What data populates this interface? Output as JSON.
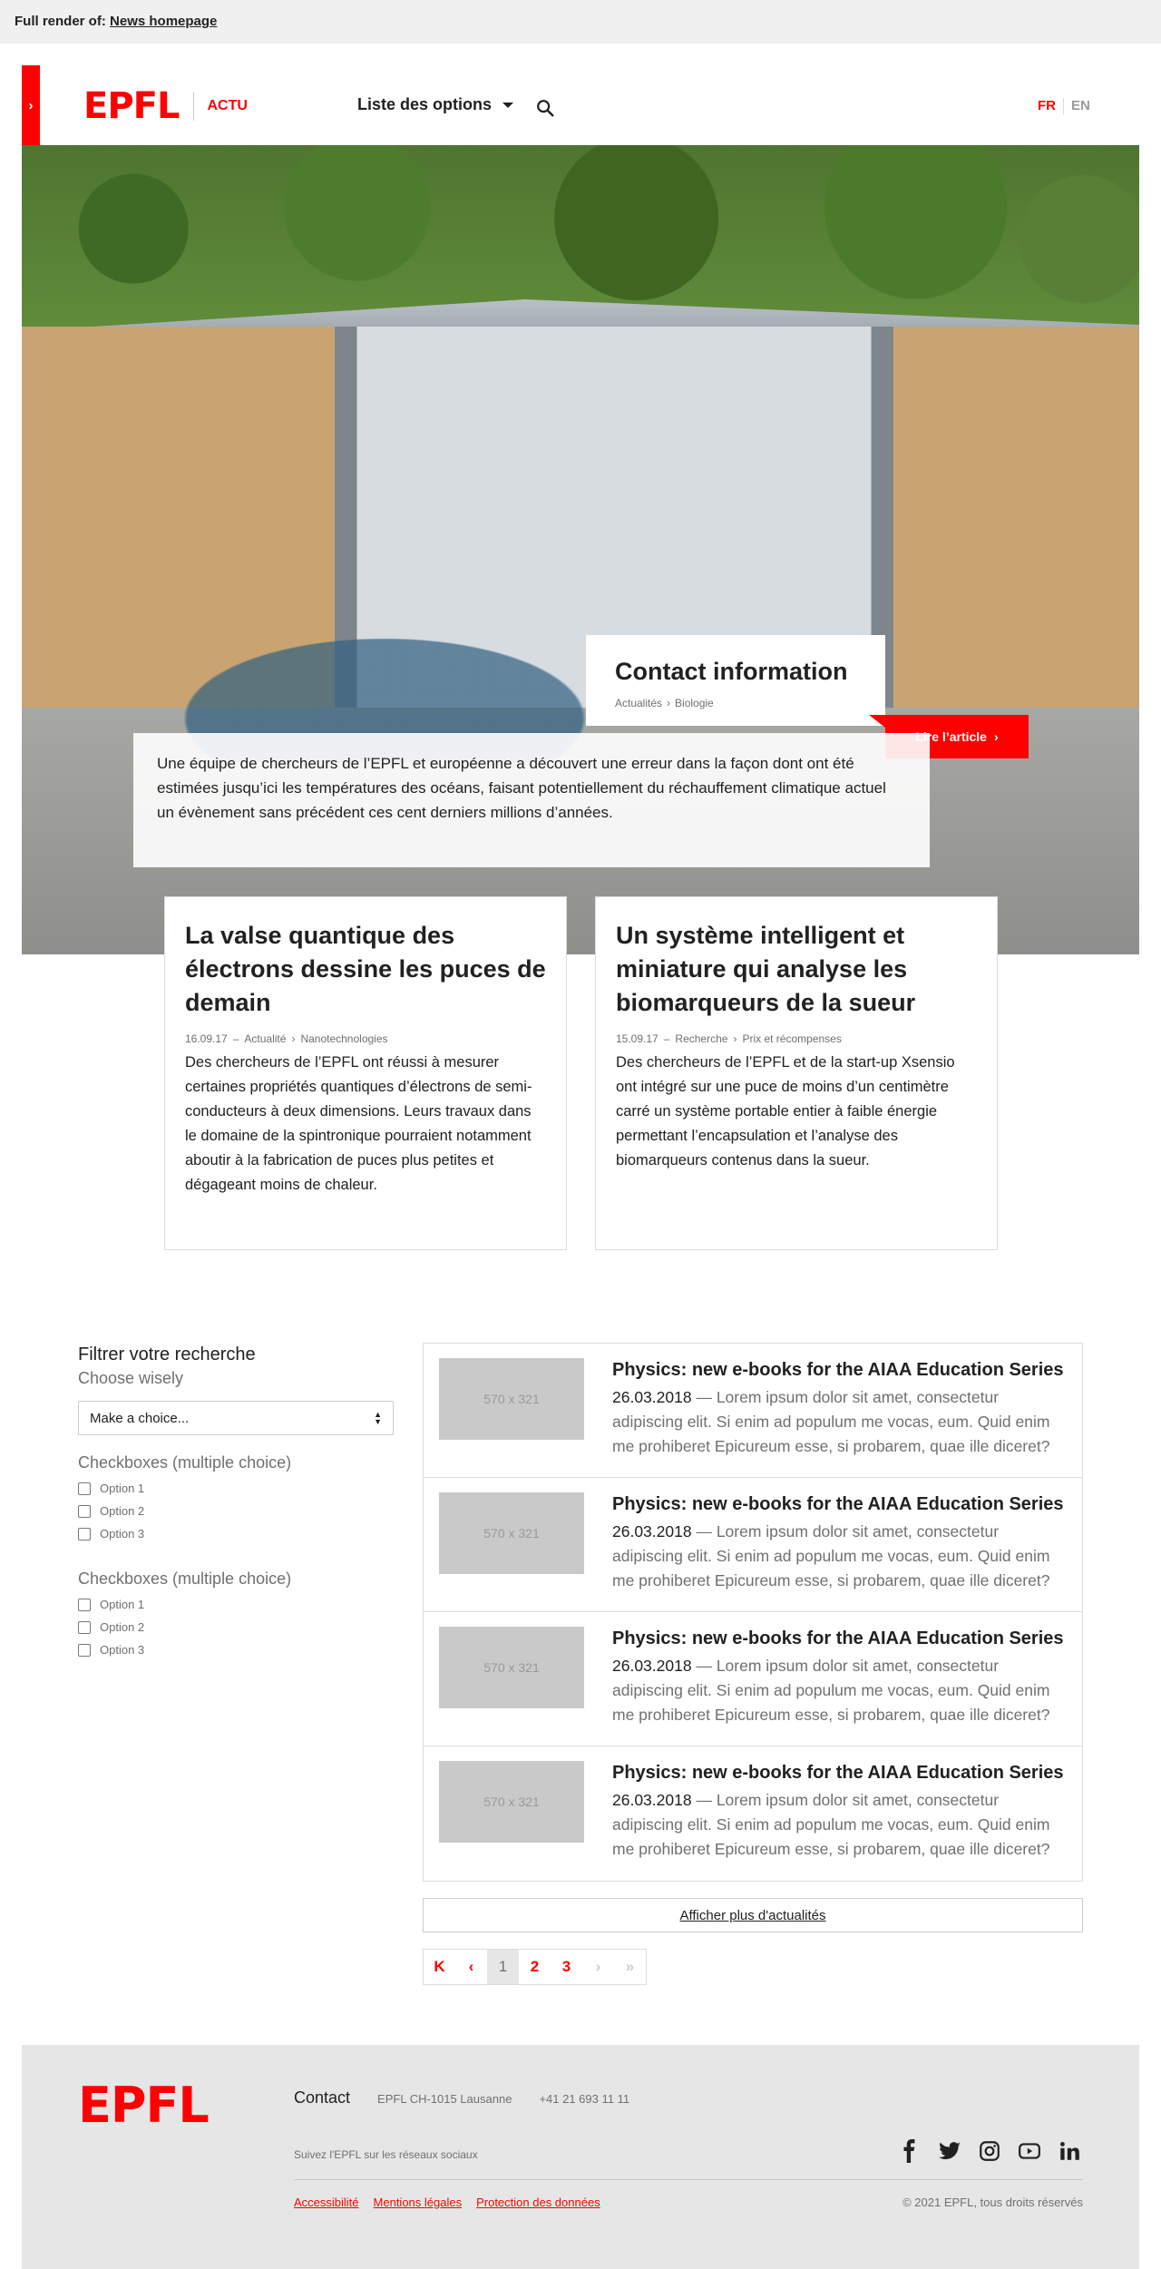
{
  "render_bar": {
    "prefix": "Full render of:",
    "link": "News homepage"
  },
  "header": {
    "drawer_glyph": "›",
    "logo": "EPFL",
    "site_name": "ACTU",
    "menu_label": "Liste des options",
    "languages": {
      "active": "FR",
      "inactive": "EN"
    }
  },
  "hero": {
    "title": "Contact information",
    "breadcrumb": [
      "Actualités",
      "Biologie"
    ],
    "read_label": "Lire l’article",
    "excerpt": "Une équipe de chercheurs de l’EPFL et européenne a découvert une erreur dans la façon dont ont été estimées jusqu’ici les températures des océans, faisant potentiellement du réchauffement climatique actuel un évènement sans précédent ces cent derniers millions d’années."
  },
  "cards": [
    {
      "title": "La valse quantique des électrons dessine les puces de demain",
      "date": "16.09.17",
      "category": "Actualité",
      "topic": "Nanotechnologies",
      "text": "Des chercheurs de l’EPFL ont réussi à mesurer certaines propriétés quantiques d’électrons de semi-conducteurs à deux dimensions. Leurs travaux dans le domaine de la spintronique pourraient notamment aboutir à la fabrication de puces plus petites et dégageant moins de chaleur."
    },
    {
      "title": "Un système intelligent et miniature qui analyse les biomarqueurs de la sueur",
      "date": "15.09.17",
      "category": "Recherche",
      "topic": "Prix et récompenses",
      "text": "Des chercheurs de l’EPFL et de la start-up Xsensio ont intégré sur une puce de moins d’un centimètre carré un système portable entier à faible énergie permettant l’encapsulation et l’analyse des biomarqueurs contenus dans la sueur."
    }
  ],
  "filter": {
    "title": "Filtrer votre recherche",
    "subtitle": "Choose wisely",
    "select_value": "Make a choice...",
    "groups": [
      {
        "label": "Checkboxes (multiple choice)",
        "options": [
          "Option 1",
          "Option 2",
          "Option 3"
        ]
      },
      {
        "label": "Checkboxes (multiple choice)",
        "options": [
          "Option 1",
          "Option 2",
          "Option 3"
        ]
      }
    ]
  },
  "news": [
    {
      "thumb": "570 x 321",
      "title": "Physics: new e-books for the AIAA Education Series",
      "date": "26.03.2018",
      "text": " — Lorem ipsum dolor sit amet, consectetur adipiscing elit. Si enim ad populum me vocas, eum. Quid enim me prohiberet Epicureum esse, si probarem, quae ille diceret?"
    },
    {
      "thumb": "570 x 321",
      "title": "Physics: new e-books for the AIAA Education Series",
      "date": "26.03.2018",
      "text": " — Lorem ipsum dolor sit amet, consectetur adipiscing elit. Si enim ad populum me vocas, eum. Quid enim me prohiberet Epicureum esse, si probarem, quae ille diceret?"
    },
    {
      "thumb": "570 x 321",
      "title": "Physics: new e-books for the AIAA Education Series",
      "date": "26.03.2018",
      "text": " — Lorem ipsum dolor sit amet, consectetur adipiscing elit. Si enim ad populum me vocas, eum. Quid enim me prohiberet Epicureum esse, si probarem, quae ille diceret?"
    },
    {
      "thumb": "570 x 321",
      "title": "Physics: new e-books for the AIAA Education Series",
      "date": "26.03.2018",
      "text": " — Lorem ipsum dolor sit amet, consectetur adipiscing elit. Si enim ad populum me vocas, eum. Quid enim me prohiberet Epicureum esse, si probarem, quae ille diceret?"
    }
  ],
  "more_label": "Afficher plus d'actualités",
  "pagination": {
    "first": "K",
    "prev": "‹",
    "pages": [
      "1",
      "2",
      "3"
    ],
    "current": "1",
    "next": "›",
    "last": "»"
  },
  "footer": {
    "logo": "EPFL",
    "contact_label": "Contact",
    "address": "EPFL CH-1015 Lausanne",
    "phone": "+41 21 693 11 11",
    "social_label": "Suivez l'EPFL sur les réseaux sociaux",
    "social_icons": [
      "facebook-icon",
      "twitter-icon",
      "instagram-icon",
      "youtube-icon",
      "linkedin-icon"
    ],
    "links": [
      "Accessibilité",
      "Mentions légales",
      "Protection des données"
    ],
    "copyright": "© 2021 EPFL, tous droits réservés"
  },
  "colors": {
    "accent": "#ff0000",
    "text": "#212121",
    "muted": "#707070",
    "footer_bg": "#e6e6e6"
  }
}
